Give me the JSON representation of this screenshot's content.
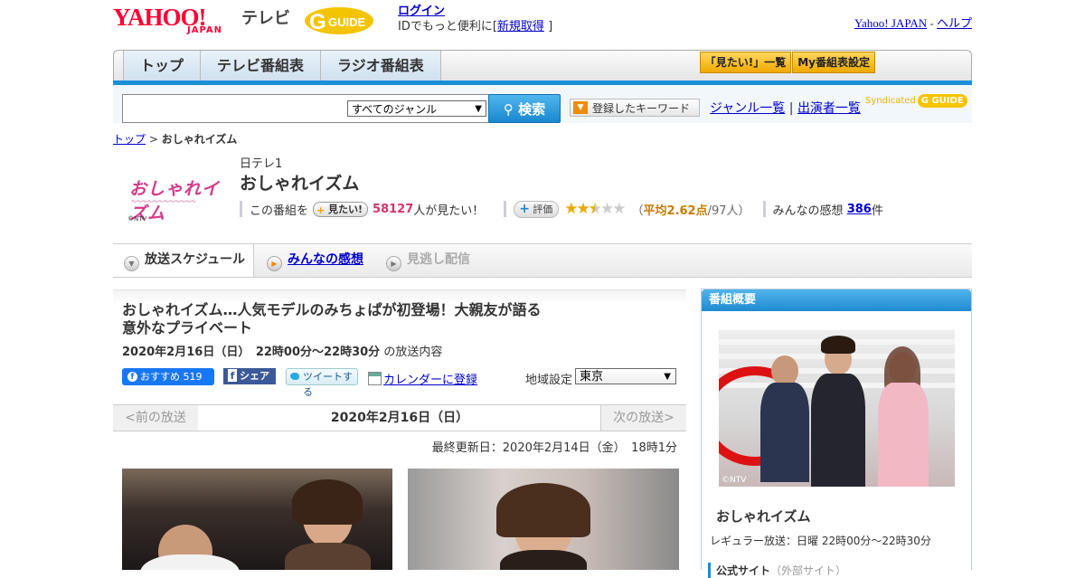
{
  "header": {
    "yahoo": "YAHOO!",
    "japan": "JAPAN",
    "tv": "テレビ",
    "gguide": "G GUIDE",
    "login": "ログイン",
    "login_sub": "IDでもっと便利に[",
    "signup": "新規取得",
    "bracket_close": "]",
    "yahoo_japan_link": "Yahoo! JAPAN",
    "dash": "-",
    "help_link": "ヘルプ"
  },
  "nav": {
    "tabs": [
      "トップ",
      "テレビ番組表",
      "ラジオ番組表"
    ],
    "mitai_list": "「見たい!」一覧",
    "my_bangumi": "My番組表設定"
  },
  "search": {
    "genre_selected": "すべてのジャンル",
    "search_button": "検索",
    "keyword_button": "登録したキーワード",
    "genre_list": "ジャンル一覧",
    "divider": "|",
    "performers": "出演者一覧",
    "syndicated": "Syndicated",
    "gguide_small": "G GUIDE"
  },
  "breadcrumb": {
    "top": "トップ",
    "sep": ">",
    "current": "おしゃれイズム"
  },
  "program": {
    "logo_text": "おしゃれイズム",
    "ntv_mark": "©NTV",
    "station": "日テレ1",
    "title": "おしゃれイズム",
    "this_program": "この番組を",
    "mitai_btn": "見たい!",
    "mitai_count": "58127",
    "mitai_suffix": "人が見たい！",
    "hyoka_btn": "評価",
    "rating_stars": 2.62,
    "avg_open": "（",
    "avg_label": "平均2.62点",
    "avg_count": "/97人）",
    "kanso_label": "みんなの感想",
    "kanso_count": "386",
    "kanso_suffix": "件"
  },
  "subtabs": {
    "schedule": "放送スケジュール",
    "reviews": "みんなの感想",
    "missed": "見逃し配信"
  },
  "episode": {
    "title": "おしゃれイズム…人気モデルのみちょぱが初登場！大親友が語る意外なプライベート",
    "date": "2020年2月16日（日）　22時00分～22時30分",
    "date_suffix": "の放送内容",
    "fb_recommend": "おすすめ 519",
    "fb_share": "シェア",
    "tweet": "ツイートする",
    "calendar": "カレンダーに登録",
    "region_label": "地域設定",
    "region_value": "東京"
  },
  "datenav": {
    "prev": "<前の放送",
    "current": "2020年2月16日（日）",
    "next": "次の放送>"
  },
  "updated": "最終更新日：2020年2月14日（金）　18時1分",
  "sidebar": {
    "header": "番組概要",
    "ntv_mark": "©NTV",
    "program_name": "おしゃれイズム",
    "regular": "レギュラー放送：日曜 22時00分～22時30分",
    "official_site": "公式サイト",
    "external": "（外部サイト）"
  }
}
